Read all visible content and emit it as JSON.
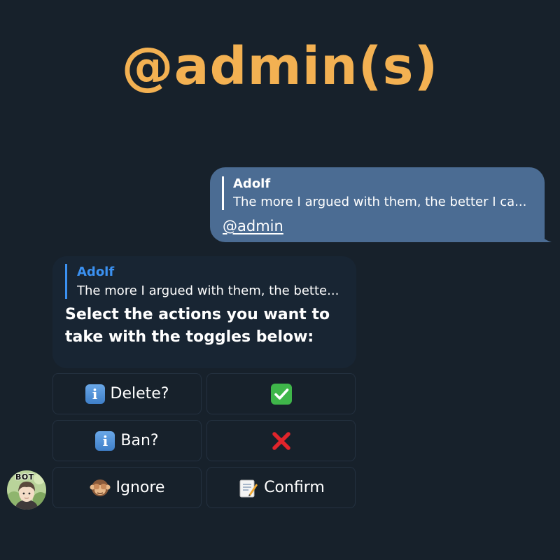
{
  "header": {
    "title": "@admin(s)"
  },
  "outgoing_message": {
    "reply_to_name": "Adolf",
    "reply_to_text": "The more I argued with them, the better I ca...",
    "text": "@admin"
  },
  "incoming_message": {
    "reply_to_name": "Adolf",
    "reply_to_text": "The more I argued with them, the bette...",
    "text": "Select the actions you want to take with the toggles below:"
  },
  "keyboard": {
    "rows": [
      [
        {
          "label": "Delete?",
          "icon": "info-icon"
        },
        {
          "label": "",
          "icon": "check-mark-icon"
        }
      ],
      [
        {
          "label": "Ban?",
          "icon": "info-icon"
        },
        {
          "label": "",
          "icon": "cross-mark-icon"
        }
      ],
      [
        {
          "label": "Ignore",
          "icon": "see-no-evil-monkey-icon"
        },
        {
          "label": "Confirm",
          "icon": "memo-icon"
        }
      ]
    ]
  },
  "avatar": {
    "badge": "BOT"
  },
  "colors": {
    "background": "#17212b",
    "title": "#f3b152",
    "outgoing_bubble": "#4b6c93",
    "incoming_bubble": "#182533",
    "reply_accent": "#3b91f1",
    "button_border": "#243140"
  }
}
